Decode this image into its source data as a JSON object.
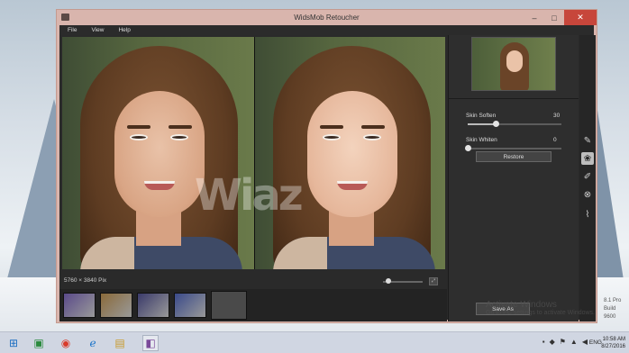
{
  "window": {
    "title": "WidsMob Retoucher",
    "controls": {
      "minimize": "–",
      "maximize": "□",
      "close": "✕"
    }
  },
  "menu": {
    "items": [
      "File",
      "View",
      "Help"
    ]
  },
  "photo": {
    "dimensions": "5760 × 3840 Pix",
    "watermark": "Wiaz"
  },
  "adjustments": {
    "skin_soften": {
      "label": "Skin Soften",
      "value": "30",
      "fraction": 0.3
    },
    "skin_whiten": {
      "label": "Skin Whiten",
      "value": "0",
      "fraction": 0
    },
    "restore_label": "Restore",
    "save_label": "Save As"
  },
  "zoom": {
    "fraction": 0.1,
    "fit_label": "⤢"
  },
  "filmstrip": {
    "thumbnails": [
      {
        "name": "thumb-1",
        "color": "#5a4a8a"
      },
      {
        "name": "thumb-2",
        "color": "#8a6a3a"
      },
      {
        "name": "thumb-3",
        "color": "#3a3a6a"
      },
      {
        "name": "thumb-4",
        "color": "#3a4a8a"
      },
      {
        "name": "thumb-5",
        "color": "#4a4a4a",
        "selected": true
      }
    ]
  },
  "tools": [
    "pencil-icon",
    "flower-icon",
    "brush-icon",
    "color-circles-icon",
    "eraser-icon"
  ],
  "activation": {
    "title": "Activate Windows",
    "subtitle": "Go to PC settings to activate Windows."
  },
  "os_build": {
    "line1": "8.1 Pro",
    "line2": "Build 9600"
  },
  "taskbar": {
    "language": "ENG",
    "time": "10:58 AM",
    "date": "8/27/2016"
  },
  "colors": {
    "window_frame": "#d9b5ad",
    "close_button": "#c7463b",
    "panel": "#2e2e2e"
  }
}
